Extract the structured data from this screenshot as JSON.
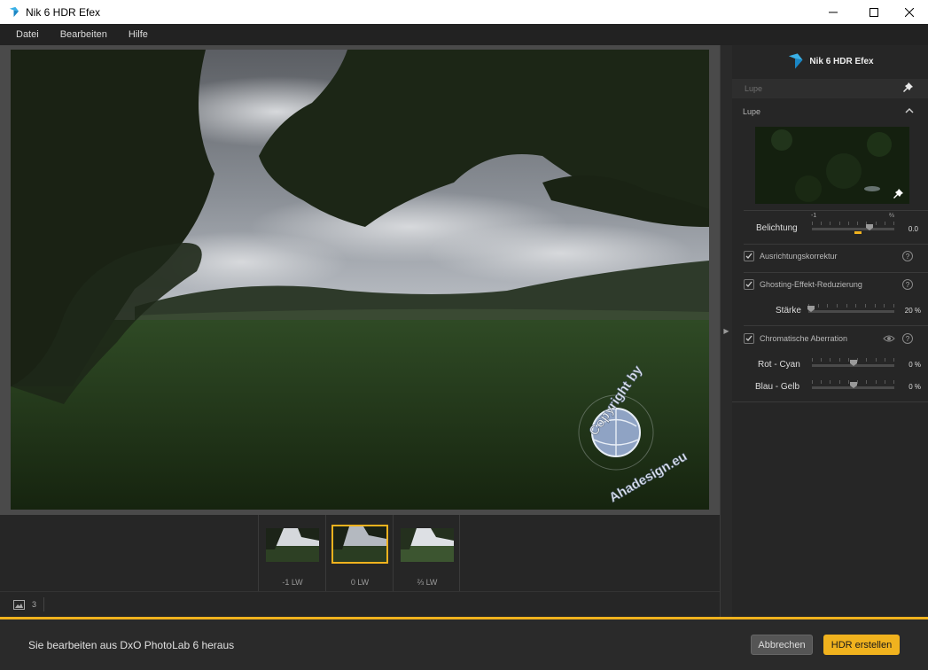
{
  "window": {
    "title": "Nik 6 HDR Efex"
  },
  "menu": [
    "Datei",
    "Bearbeiten",
    "Hilfe"
  ],
  "watermark": {
    "line1": "Copyright by",
    "line2": "Ahadesign.eu"
  },
  "filmstrip": [
    {
      "label": "-1 LW",
      "selected": false
    },
    {
      "label": "0 LW",
      "selected": true
    },
    {
      "label": "⅔ LW",
      "selected": false
    }
  ],
  "status": {
    "image_count": "3"
  },
  "panel": {
    "header": "Nik 6 HDR Efex",
    "lupe_bar": "Lupe",
    "lupe_section": "Lupe",
    "belichtung": {
      "label": "Belichtung",
      "value": "0.0",
      "tick_min": "-1",
      "tick_max": "⅔",
      "level": 0.7
    },
    "ausrichtung": {
      "label": "Ausrichtungskorrektur",
      "checked": true
    },
    "ghosting": {
      "label": "Ghosting-Effekt-Reduzierung",
      "checked": true
    },
    "staerke": {
      "label": "Stärke",
      "value": "20 %",
      "level": 0.0
    },
    "chromatisch": {
      "label": "Chromatische Aberration",
      "checked": true
    },
    "rot_cyan": {
      "label": "Rot - Cyan",
      "value": "0 %",
      "level": 0.5
    },
    "blau_gelb": {
      "label": "Blau - Gelb",
      "value": "0 %",
      "level": 0.5
    },
    "help_glyph": "?"
  },
  "footer": {
    "message": "Sie bearbeiten aus DxO PhotoLab 6 heraus",
    "cancel": "Abbrechen",
    "create": "HDR erstellen"
  },
  "colors": {
    "accent": "#f0b21e",
    "panel_bg": "#262626",
    "title_bg": "#ffffff"
  }
}
